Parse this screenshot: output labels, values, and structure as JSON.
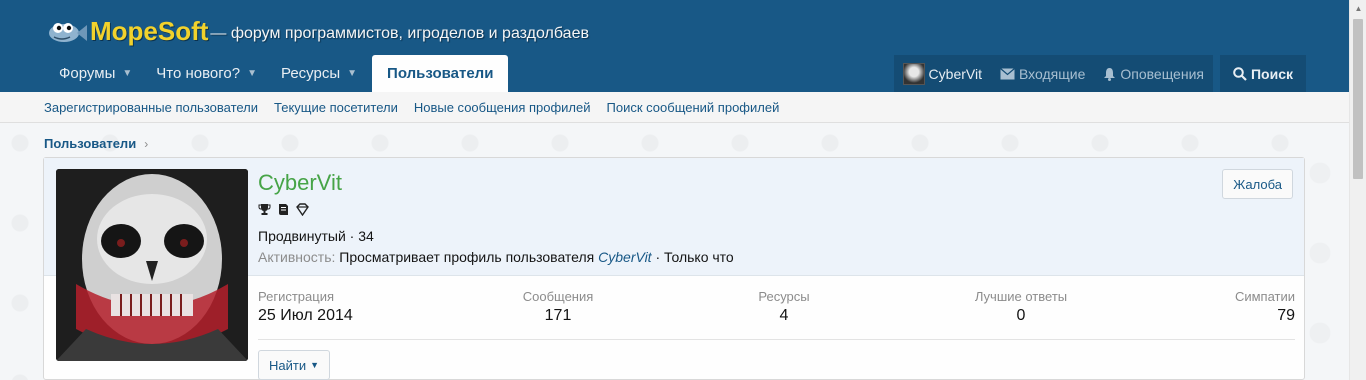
{
  "brand": {
    "name": "MopeSoft",
    "tagline": "— форум программистов, игроделов и раздолбаев"
  },
  "nav": {
    "tabs": [
      {
        "label": "Форумы",
        "has_menu": true
      },
      {
        "label": "Что нового?",
        "has_menu": true
      },
      {
        "label": "Ресурсы",
        "has_menu": true
      },
      {
        "label": "Пользователи",
        "active": true
      }
    ]
  },
  "user_nav": {
    "username": "CyberVit",
    "inbox": "Входящие",
    "alerts": "Оповещения",
    "search": "Поиск"
  },
  "subnav": {
    "links": [
      "Зарегистрированные пользователи",
      "Текущие посетители",
      "Новые сообщения профилей",
      "Поиск сообщений профилей"
    ]
  },
  "breadcrumb": {
    "item": "Пользователи",
    "separator": "›"
  },
  "profile": {
    "username": "CyberVit",
    "badges": [
      "trophy-icon",
      "document-icon",
      "diamond-icon"
    ],
    "title_line": "Продвинутый · 34",
    "activity_label": "Активность:",
    "activity_text": "Просматривает профиль пользователя",
    "activity_link": "CyberVit",
    "activity_time": "· Только что",
    "report_button": "Жалоба",
    "find_button": "Найти",
    "stats": [
      {
        "label": "Регистрация",
        "value": "25 Июл 2014"
      },
      {
        "label": "Сообщения",
        "value": "171"
      },
      {
        "label": "Ресурсы",
        "value": "4"
      },
      {
        "label": "Лучшие ответы",
        "value": "0"
      },
      {
        "label": "Симпатии",
        "value": "79"
      }
    ]
  },
  "colors": {
    "header": "#185886",
    "accent_yellow": "#f2d22c",
    "username_green": "#47a447"
  }
}
